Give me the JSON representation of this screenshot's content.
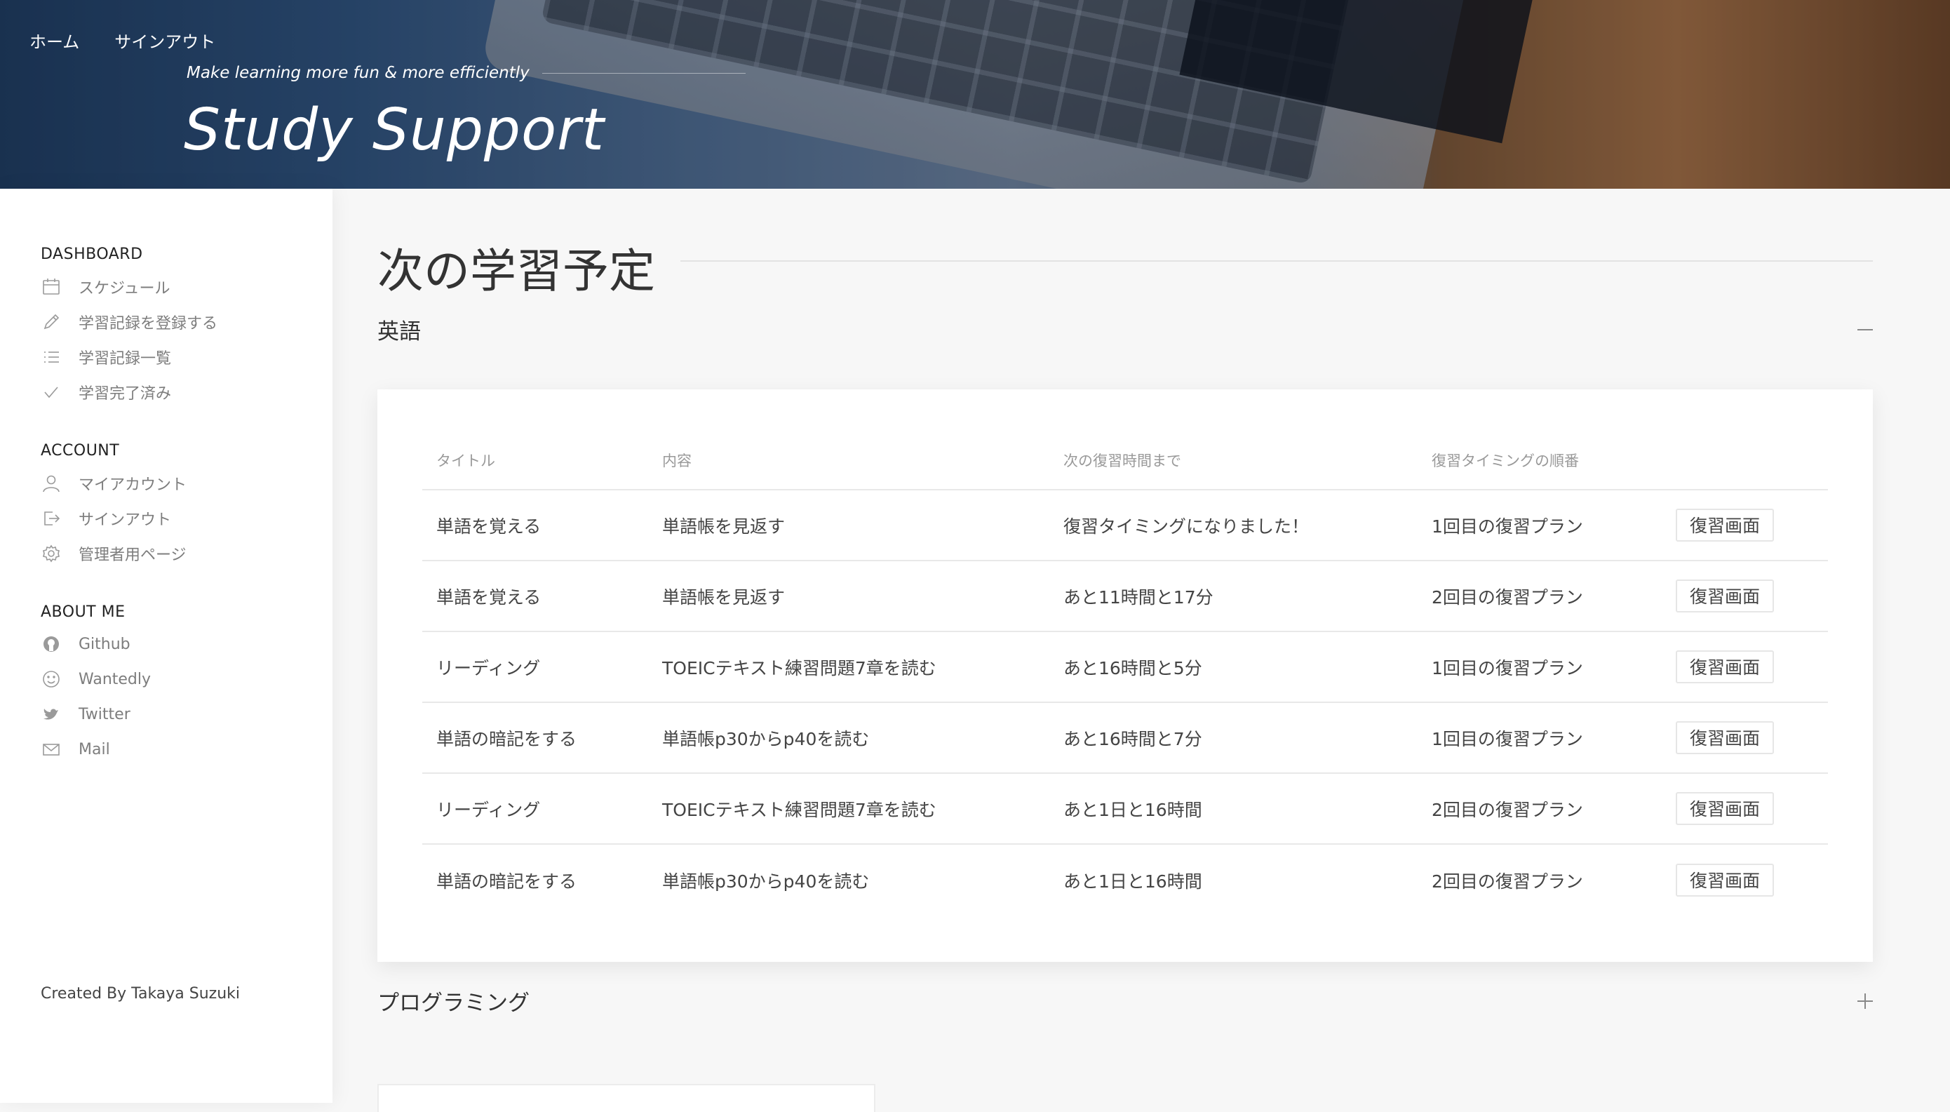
{
  "top_nav": {
    "home": "ホーム",
    "signout": "サインアウト"
  },
  "hero": {
    "tagline": "Make learning more fun & more efficiently",
    "title": "Study Support"
  },
  "sidebar": {
    "dashboard_title": "DASHBOARD",
    "dashboard_items": [
      {
        "label": "スケジュール",
        "icon": "calendar-icon"
      },
      {
        "label": "学習記録を登録する",
        "icon": "pencil-icon"
      },
      {
        "label": "学習記録一覧",
        "icon": "list-icon"
      },
      {
        "label": "学習完了済み",
        "icon": "check-icon"
      }
    ],
    "account_title": "ACCOUNT",
    "account_items": [
      {
        "label": "マイアカウント",
        "icon": "user-icon"
      },
      {
        "label": "サインアウト",
        "icon": "signout-icon"
      },
      {
        "label": "管理者用ページ",
        "icon": "gear-icon"
      }
    ],
    "about_title": "ABOUT ME",
    "about_items": [
      {
        "label": "Github",
        "icon": "github-icon"
      },
      {
        "label": "Wantedly",
        "icon": "smile-icon"
      },
      {
        "label": "Twitter",
        "icon": "twitter-icon"
      },
      {
        "label": "Mail",
        "icon": "mail-icon"
      }
    ],
    "credit": "Created By Takaya Suzuki"
  },
  "main": {
    "page_title": "次の学習予定",
    "categories": [
      {
        "name": "英語",
        "expanded": true,
        "columns": [
          "タイトル",
          "内容",
          "次の復習時間まで",
          "復習タイミングの順番",
          ""
        ],
        "rows": [
          {
            "title": "単語を覚える",
            "content": "単語帳を見返す",
            "next": "復習タイミングになりました！",
            "order": "1回目の復習プラン",
            "button": "復習画面"
          },
          {
            "title": "単語を覚える",
            "content": "単語帳を見返す",
            "next": "あと11時間と17分",
            "order": "2回目の復習プラン",
            "button": "復習画面"
          },
          {
            "title": "リーディング",
            "content": "TOEICテキスト練習問題7章を読む",
            "next": "あと16時間と5分",
            "order": "1回目の復習プラン",
            "button": "復習画面"
          },
          {
            "title": "単語の暗記をする",
            "content": "単語帳p30からp40を読む",
            "next": "あと16時間と7分",
            "order": "1回目の復習プラン",
            "button": "復習画面"
          },
          {
            "title": "リーディング",
            "content": "TOEICテキスト練習問題7章を読む",
            "next": "あと1日と16時間",
            "order": "2回目の復習プラン",
            "button": "復習画面"
          },
          {
            "title": "単語の暗記をする",
            "content": "単語帳p30からp40を読む",
            "next": "あと1日と16時間",
            "order": "2回目の復習プラン",
            "button": "復習画面"
          }
        ]
      },
      {
        "name": "プログラミング",
        "expanded": false
      }
    ]
  },
  "colors": {
    "accent": "#3b8fd6",
    "sidebar_bg": "#ffffff",
    "main_bg": "#f7f7f7"
  }
}
